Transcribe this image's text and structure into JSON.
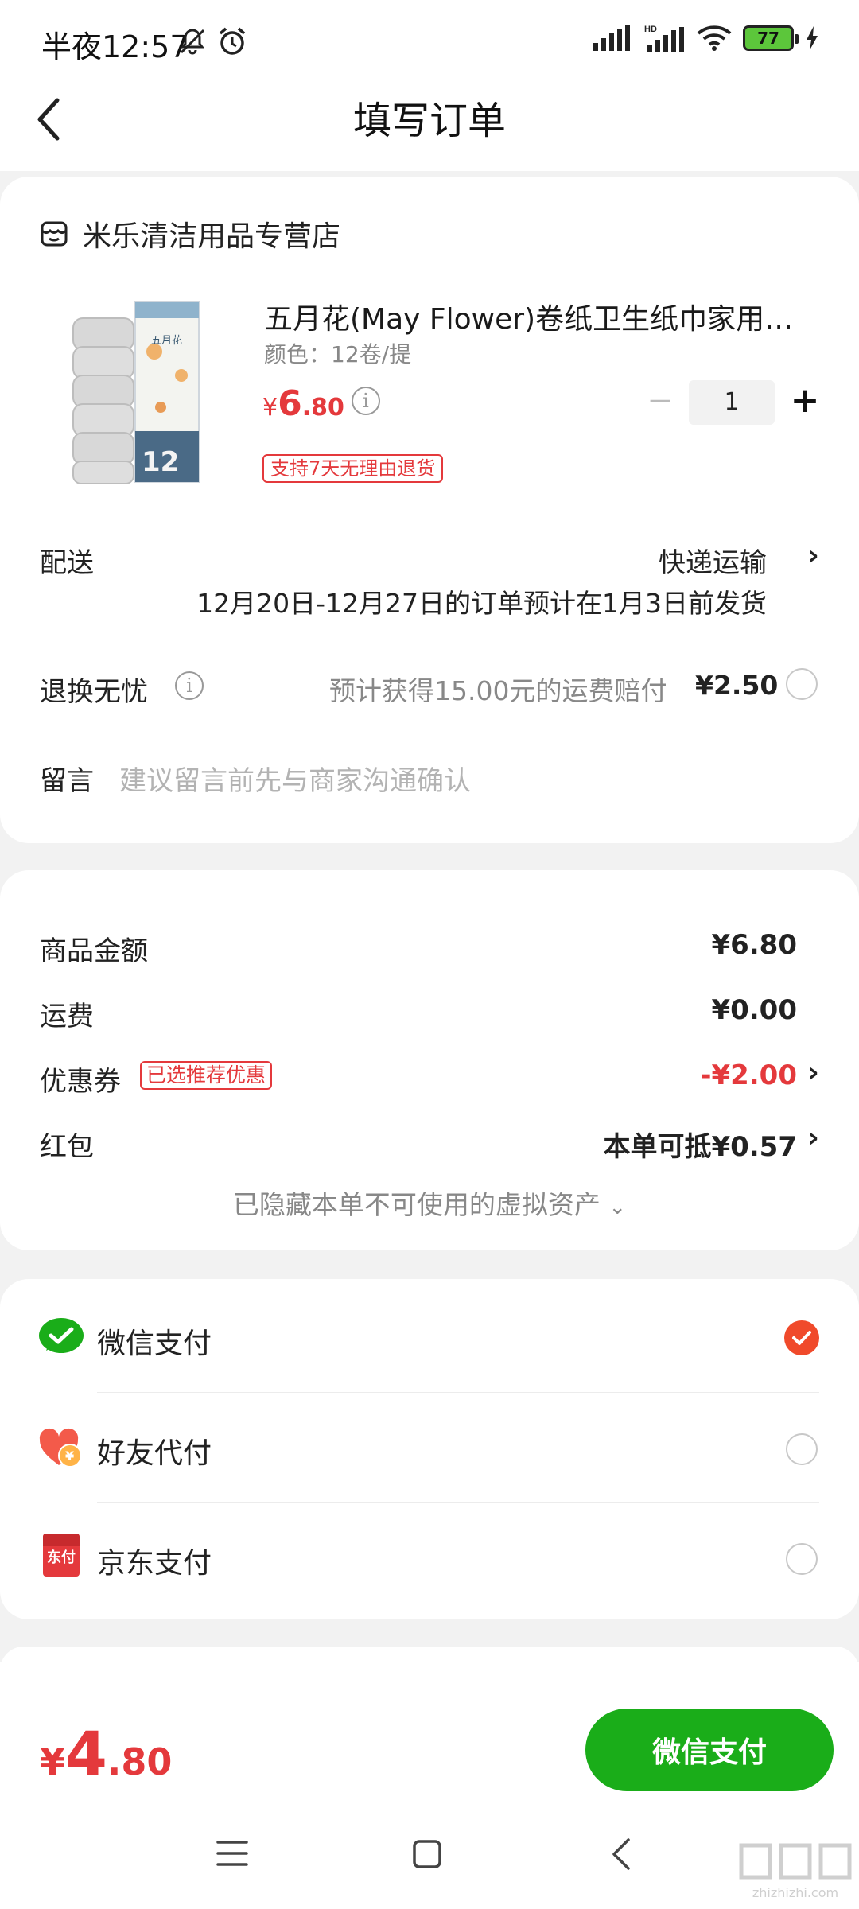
{
  "status_bar": {
    "time": "半夜12:57",
    "battery": "77"
  },
  "header": {
    "title": "填写订单"
  },
  "store": {
    "name": "米乐清洁用品专营店"
  },
  "product": {
    "title": "五月花(May Flower)卷纸卫生纸巾家用厕…",
    "spec": "颜色：12卷/提",
    "price_symbol": "¥",
    "price_int": "6",
    "price_dec": ".80",
    "quantity": "1",
    "tag": "支持7天无理由退货",
    "image_brand": "五月花"
  },
  "delivery": {
    "label": "配送",
    "method": "快递运输",
    "note": "12月20日-12月27日的订单预计在1月3日前发货"
  },
  "return_insurance": {
    "label": "退换无忧",
    "text": "预计获得15.00元的运费赔付",
    "price": "¥2.50"
  },
  "message": {
    "label": "留言",
    "placeholder": "建议留言前先与商家沟通确认"
  },
  "summary": {
    "goods_label": "商品金额",
    "goods_value": "¥6.80",
    "freight_label": "运费",
    "freight_value": "¥0.00",
    "coupon_label": "优惠券",
    "coupon_tag": "已选推荐优惠",
    "coupon_value": "-¥2.00",
    "redpacket_label": "红包",
    "redpacket_value": "本单可抵¥0.57",
    "hidden_note": "已隐藏本单不可使用的虚拟资产"
  },
  "payment": {
    "methods": [
      {
        "label": "微信支付",
        "selected": true
      },
      {
        "label": "好友代付",
        "selected": false
      },
      {
        "label": "京东支付",
        "selected": false
      }
    ],
    "jd_icon_text": "东付"
  },
  "footer": {
    "total_symbol": "¥",
    "total_int": "4",
    "total_dec": ".80",
    "pay_button": "微信支付"
  },
  "watermark": {
    "text": "zhizhizhi.com"
  },
  "colors": {
    "accent_red": "#e4393c",
    "wechat_green": "#1aad19",
    "radio_selected": "#f04a2b"
  }
}
